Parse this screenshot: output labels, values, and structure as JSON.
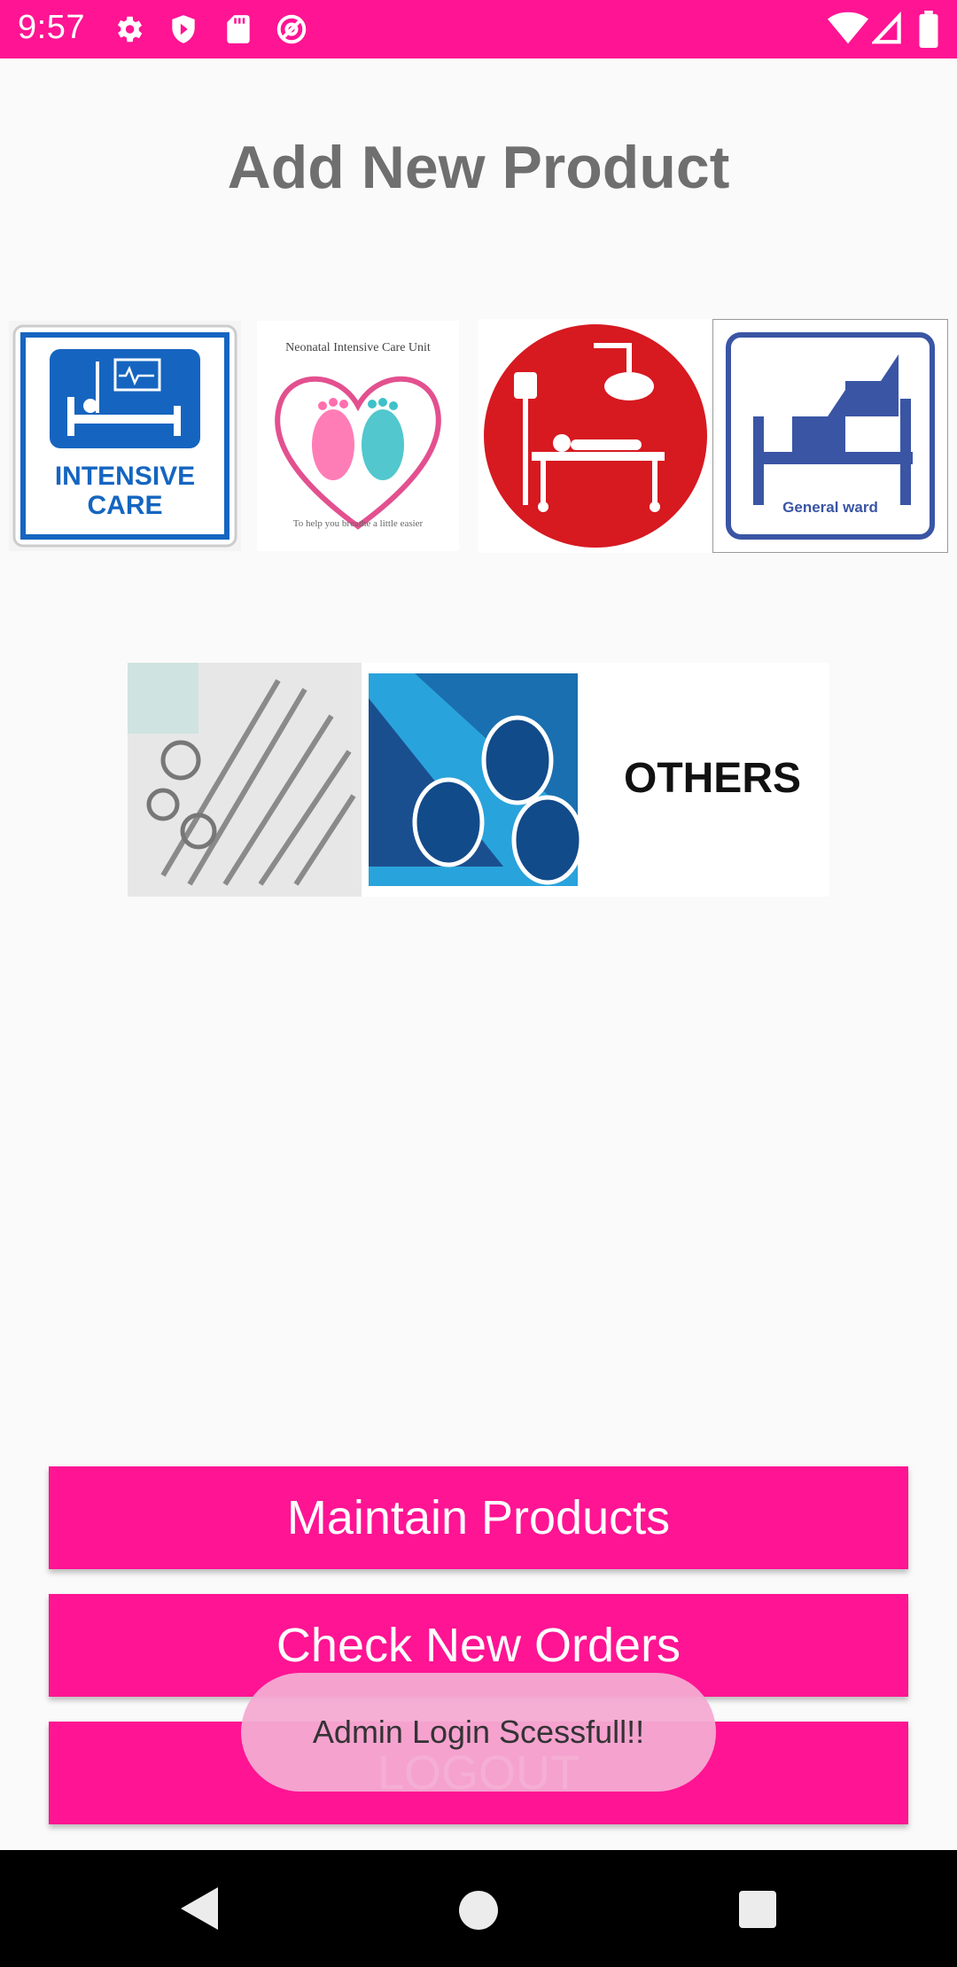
{
  "status_bar": {
    "time": "9:57",
    "background": "#ff1493",
    "left_icons": [
      "settings-icon",
      "shield-play-icon",
      "sd-card-icon",
      "at-sign-icon"
    ],
    "right_icons": [
      "wifi-icon",
      "cellular-signal-icon",
      "battery-icon"
    ]
  },
  "page": {
    "title": "Add New Product"
  },
  "categories": {
    "row1": [
      {
        "name": "intensive-care",
        "line1": "INTENSIVE",
        "line2": "CARE"
      },
      {
        "name": "nicu",
        "caption": "Neonatal Intensive Care Unit",
        "tagline": "To help you breathe a little easier"
      },
      {
        "name": "operation-theatre"
      },
      {
        "name": "general-ward",
        "caption": "General ward"
      }
    ],
    "row2": [
      {
        "name": "surgical-instruments"
      },
      {
        "name": "pipes"
      },
      {
        "name": "others",
        "label": "OTHERS"
      }
    ]
  },
  "buttons": {
    "maintain": "Maintain Products",
    "check_orders": "Check New Orders",
    "logout": "LOGOUT"
  },
  "toast": {
    "message": "Admin Login Scessfull!!"
  },
  "navigation": [
    "back-icon",
    "home-icon",
    "recents-icon"
  ],
  "colors": {
    "accent": "#ff1493",
    "title": "#6f6f6f"
  }
}
